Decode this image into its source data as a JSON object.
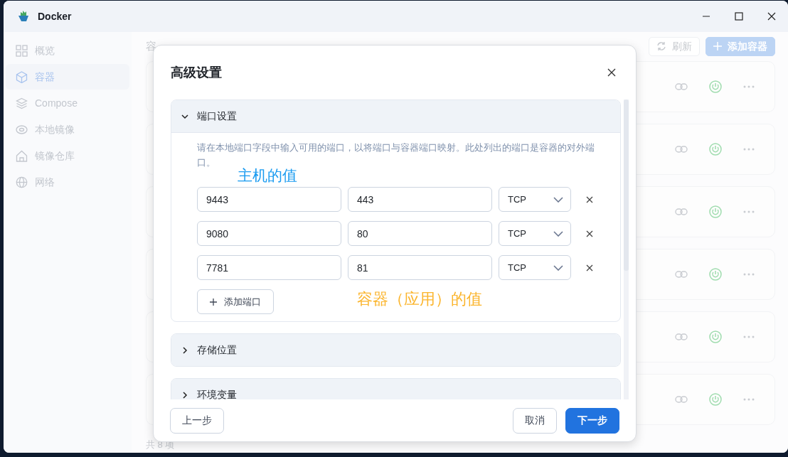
{
  "window": {
    "title": "Docker"
  },
  "sidebar": {
    "items": [
      {
        "label": "概览",
        "selected": false
      },
      {
        "label": "容器",
        "selected": true
      },
      {
        "label": "Compose",
        "selected": false
      },
      {
        "label": "本地镜像",
        "selected": false
      },
      {
        "label": "镜像仓库",
        "selected": false
      },
      {
        "label": "网络",
        "selected": false
      }
    ]
  },
  "page": {
    "heading": "容",
    "toolbar": [
      {
        "label": "刷新",
        "kind": "refresh"
      },
      {
        "label": "添加容器",
        "kind": "add"
      }
    ],
    "container_cards": [
      {
        "running": true
      },
      {
        "running": true
      },
      {
        "running": true
      },
      {
        "running": true
      },
      {
        "running": true
      },
      {
        "running": true
      }
    ],
    "footer": "共 8 项"
  },
  "dialog": {
    "title": "高级设置",
    "sections": [
      {
        "title": "端口设置",
        "expanded": true,
        "description": "请在本地端口字段中输入可用的端口，以将端口与容器端口映射。此处列出的端口是容器的对外端口。",
        "ports": [
          {
            "host": "9443",
            "container": "443",
            "protocol": "TCP"
          },
          {
            "host": "9080",
            "container": "80",
            "protocol": "TCP"
          },
          {
            "host": "7781",
            "container": "81",
            "protocol": "TCP"
          }
        ],
        "add_button": "添加端口"
      },
      {
        "title": "存储位置",
        "expanded": false
      },
      {
        "title": "环境变量",
        "expanded": false
      }
    ],
    "annotations": [
      {
        "text": "主机的值",
        "color": "#1a9bf0",
        "kind": "host"
      },
      {
        "text": "容器（应用）的值",
        "color": "#fbb52d",
        "kind": "container"
      }
    ],
    "buttons": [
      {
        "label": "上一步",
        "kind": "secondary"
      },
      {
        "label": "取消",
        "kind": "secondary"
      },
      {
        "label": "下一步",
        "kind": "primary"
      }
    ]
  }
}
